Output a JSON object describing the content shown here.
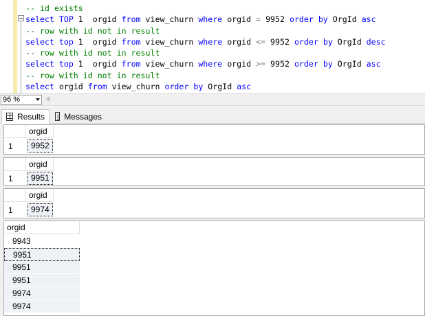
{
  "editor": {
    "lines": [
      [
        {
          "t": "-- id exists",
          "c": "comment"
        }
      ],
      [
        {
          "t": "select ",
          "c": "kw"
        },
        {
          "t": "TOP ",
          "c": "kw"
        },
        {
          "t": "1  orgid ",
          "c": "plain"
        },
        {
          "t": "from ",
          "c": "kw"
        },
        {
          "t": "view_churn ",
          "c": "plain"
        },
        {
          "t": "where ",
          "c": "kw"
        },
        {
          "t": "orgid ",
          "c": "plain"
        },
        {
          "t": "= ",
          "c": "op"
        },
        {
          "t": "9952 ",
          "c": "plain"
        },
        {
          "t": "order by ",
          "c": "kw"
        },
        {
          "t": "OrgId ",
          "c": "plain"
        },
        {
          "t": "asc",
          "c": "kw"
        }
      ],
      [
        {
          "t": "-- row with id not in result",
          "c": "comment"
        }
      ],
      [
        {
          "t": "select ",
          "c": "kw"
        },
        {
          "t": "top ",
          "c": "kw"
        },
        {
          "t": "1  orgid ",
          "c": "plain"
        },
        {
          "t": "from ",
          "c": "kw"
        },
        {
          "t": "view_churn ",
          "c": "plain"
        },
        {
          "t": "where ",
          "c": "kw"
        },
        {
          "t": "orgid ",
          "c": "plain"
        },
        {
          "t": "<= ",
          "c": "op"
        },
        {
          "t": "9952 ",
          "c": "plain"
        },
        {
          "t": "order by ",
          "c": "kw"
        },
        {
          "t": "OrgId ",
          "c": "plain"
        },
        {
          "t": "desc",
          "c": "kw"
        }
      ],
      [
        {
          "t": "-- row with id not in result",
          "c": "comment"
        }
      ],
      [
        {
          "t": "select ",
          "c": "kw"
        },
        {
          "t": "top ",
          "c": "kw"
        },
        {
          "t": "1  orgid ",
          "c": "plain"
        },
        {
          "t": "from ",
          "c": "kw"
        },
        {
          "t": "view_churn ",
          "c": "plain"
        },
        {
          "t": "where ",
          "c": "kw"
        },
        {
          "t": "orgid ",
          "c": "plain"
        },
        {
          "t": ">= ",
          "c": "op"
        },
        {
          "t": "9952 ",
          "c": "plain"
        },
        {
          "t": "order by ",
          "c": "kw"
        },
        {
          "t": "OrgId ",
          "c": "plain"
        },
        {
          "t": "asc",
          "c": "kw"
        }
      ],
      [
        {
          "t": "-- row with id not in result",
          "c": "comment"
        }
      ],
      [
        {
          "t": "select ",
          "c": "kw"
        },
        {
          "t": "orgid ",
          "c": "plain"
        },
        {
          "t": "from ",
          "c": "kw"
        },
        {
          "t": "view_churn ",
          "c": "plain"
        },
        {
          "t": "order by ",
          "c": "kw"
        },
        {
          "t": "OrgId ",
          "c": "plain"
        },
        {
          "t": "asc",
          "c": "kw"
        }
      ]
    ]
  },
  "zoom": {
    "value": "96 %"
  },
  "tabs": {
    "results": "Results",
    "messages": "Messages"
  },
  "grid1": {
    "column": "orgid",
    "row_number": "1",
    "value": "9952"
  },
  "grid2": {
    "column": "orgid",
    "row_number": "1",
    "value": "9951"
  },
  "grid3": {
    "column": "orgid",
    "row_number": "1",
    "value": "9974"
  },
  "grid4": {
    "column": "orgid",
    "values": [
      "9943",
      "9951",
      "9951",
      "9951",
      "9974",
      "9974"
    ]
  },
  "colors": {
    "keyword": "#0000ff",
    "comment": "#008000",
    "operator": "#808080",
    "gutter": "#f5ecab"
  }
}
